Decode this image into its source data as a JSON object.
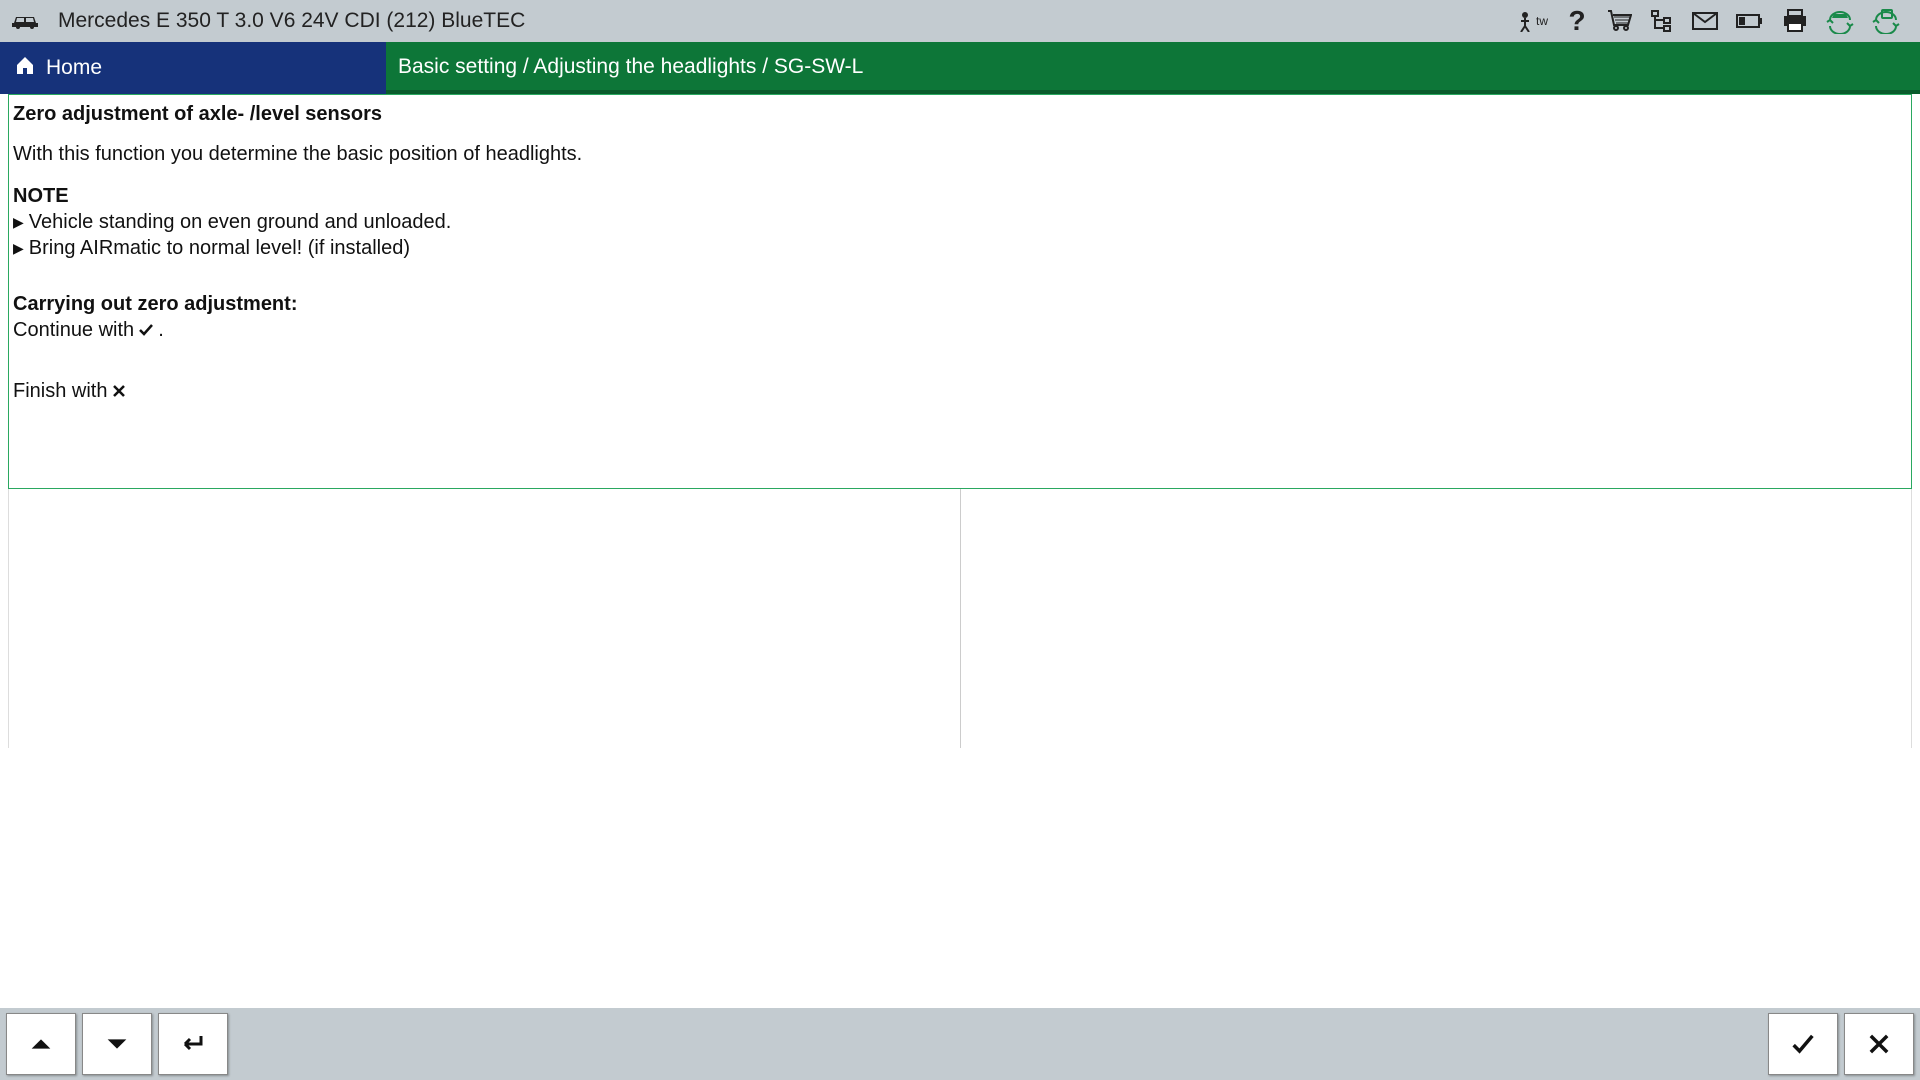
{
  "topbar": {
    "vehicle": "Mercedes E 350 T 3.0 V6 24V CDI (212) BlueTEC",
    "user": "tw"
  },
  "navbar": {
    "home_label": "Home",
    "breadcrumb": "Basic setting / Adjusting the headlights / SG-SW-L"
  },
  "content": {
    "title": "Zero adjustment of axle- /level sensors",
    "intro": "With this function you determine the basic position of headlights.",
    "note_heading": "NOTE",
    "note_items": [
      "Vehicle standing on even ground and unloaded.",
      "Bring AIRmatic to normal level! (if installed)"
    ],
    "zero_heading": "Carrying out zero adjustment:",
    "continue_prefix": "Continue with",
    "continue_suffix": ".",
    "finish_prefix": "Finish with"
  },
  "icons": {
    "car": "car-icon",
    "user": "user-icon",
    "help": "help-icon",
    "cart": "cart-icon",
    "tree": "tree-icon",
    "mail": "mail-icon",
    "battery": "battery-icon",
    "print": "print-icon",
    "sync1": "sync-car-icon",
    "sync2": "sync-device-icon"
  }
}
